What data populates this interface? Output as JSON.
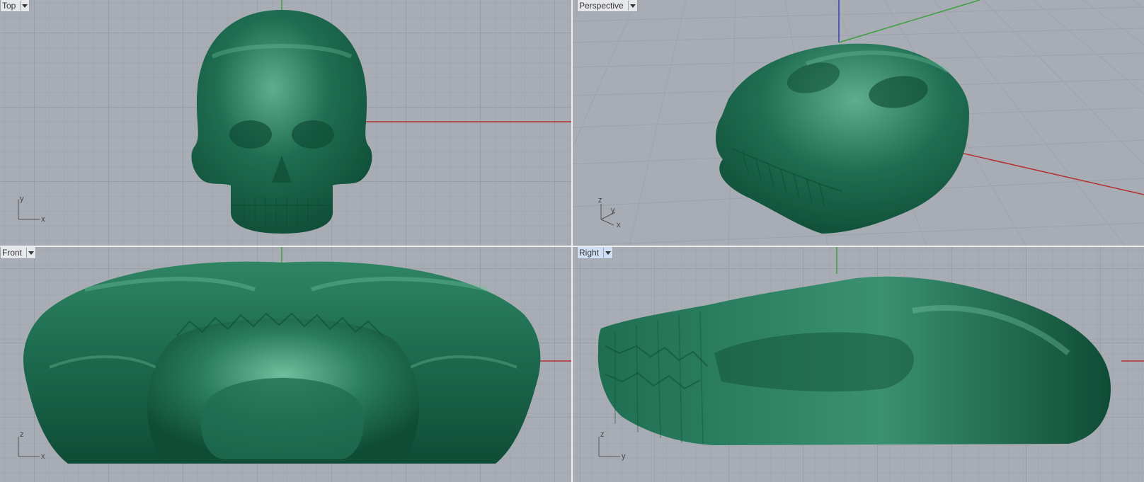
{
  "viewports": {
    "top": {
      "title": "Top",
      "axis_h": "x",
      "axis_v": "y"
    },
    "perspective": {
      "title": "Perspective",
      "axis_x": "x",
      "axis_y": "y",
      "axis_z": "z"
    },
    "front": {
      "title": "Front",
      "axis_h": "x",
      "axis_v": "z"
    },
    "right": {
      "title": "Right",
      "axis_h": "y",
      "axis_v": "z",
      "active": true
    }
  },
  "colors": {
    "viewport_bg": "#a8adb5",
    "grid_minor": "#9ea3ab",
    "grid_major": "#8c9199",
    "axis_x": "#b2312f",
    "axis_y": "#3f9e3f",
    "axis_z": "#3b3bb5",
    "model_dark": "#0f4c36",
    "model_mid": "#1f6e52",
    "model_light": "#5fae8f"
  }
}
